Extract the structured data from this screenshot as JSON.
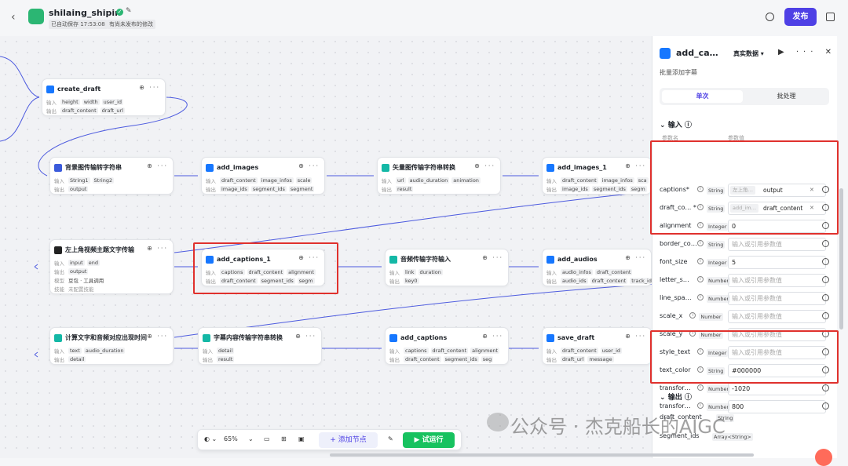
{
  "header": {
    "back": "‹",
    "title": "shilaing_shipin",
    "saved": "已自动保存 17:53:08",
    "unpublished": "有尚未发布的修改",
    "publish": "发布"
  },
  "nodes": [
    {
      "id": "create_draft",
      "title": "create_draft",
      "in_label": "输入",
      "inputs": [
        "height",
        "width",
        "user_id"
      ],
      "out_label": "输出",
      "outputs": [
        "draft_content",
        "draft_url"
      ]
    },
    {
      "id": "bg",
      "title": "背景图传输转字符串",
      "in_label": "输入",
      "inputs": [
        "String1",
        "String2"
      ],
      "out_label": "输出",
      "outputs": [
        "output"
      ]
    },
    {
      "id": "add_images",
      "title": "add_images",
      "in_label": "输入",
      "inputs": [
        "draft_content",
        "image_infos",
        "scale"
      ],
      "out_label": "输出",
      "outputs": [
        "image_ids",
        "segment_ids",
        "segment"
      ]
    },
    {
      "id": "vec",
      "title": "矢量图传输字符串转换",
      "in_label": "输入",
      "inputs": [
        "url",
        "audio_duration",
        "animation"
      ],
      "out_label": "输出",
      "outputs": [
        "result"
      ]
    },
    {
      "id": "add_images_1",
      "title": "add_images_1",
      "in_label": "输入",
      "inputs": [
        "draft_content",
        "image_infos",
        "sca"
      ],
      "out_label": "输出",
      "outputs": [
        "image_ids",
        "segment_ids",
        "segm"
      ]
    },
    {
      "id": "topleft",
      "title": "左上角视频主题文字传输",
      "in_label": "输入",
      "inputs": [
        "input",
        "end"
      ],
      "out_label": "输出",
      "outputs": [
        "output"
      ],
      "extra1_label": "模型",
      "extra1": "豆包 · 工具调用",
      "extra2_label": "技能",
      "extra2": "未配置技能"
    },
    {
      "id": "add_captions_1",
      "title": "add_captions_1",
      "in_label": "输入",
      "inputs": [
        "captions",
        "draft_content",
        "alignment"
      ],
      "out_label": "输出",
      "outputs": [
        "draft_content",
        "segment_ids",
        "segm"
      ]
    },
    {
      "id": "audio",
      "title": "音频传输字符输入",
      "in_label": "输入",
      "inputs": [
        "link",
        "duration"
      ],
      "out_label": "输出",
      "outputs": [
        "key0"
      ]
    },
    {
      "id": "add_audios",
      "title": "add_audios",
      "in_label": "输入",
      "inputs": [
        "audio_infos",
        "draft_content"
      ],
      "out_label": "输出",
      "outputs": [
        "audio_ids",
        "draft_content",
        "track_id"
      ]
    },
    {
      "id": "calc",
      "title": "计算文字和音频对应出现时间",
      "in_label": "输入",
      "inputs": [
        "text",
        "audio_duration"
      ],
      "out_label": "输出",
      "outputs": [
        "detail"
      ]
    },
    {
      "id": "captext",
      "title": "字幕内容传输字符串转换",
      "in_label": "输入",
      "inputs": [
        "detail"
      ],
      "out_label": "输出",
      "outputs": [
        "result"
      ]
    },
    {
      "id": "add_captions",
      "title": "add_captions",
      "in_label": "输入",
      "inputs": [
        "captions",
        "draft_content",
        "alignment"
      ],
      "out_label": "输出",
      "outputs": [
        "draft_content",
        "segment_ids",
        "seg"
      ]
    },
    {
      "id": "save_draft",
      "title": "save_draft",
      "in_label": "输入",
      "inputs": [
        "draft_content",
        "user_id"
      ],
      "out_label": "输出",
      "outputs": [
        "draft_url",
        "message"
      ]
    }
  ],
  "toolbar": {
    "zoom": "65%",
    "add_node": "+ 添加节点",
    "run": "▶ 试运行"
  },
  "panel": {
    "title": "add_ca…",
    "mode": "真实数据 ▾",
    "desc": "批量添加字幕",
    "tabs": [
      "单次",
      "批处理"
    ],
    "input_section": "输入",
    "col_name": "参数名",
    "col_value": "参数值",
    "params": [
      {
        "name": "captions*",
        "type": "String",
        "ref": "左上角…",
        "value": "output",
        "kind": "ref"
      },
      {
        "name": "draft_co… *",
        "type": "String",
        "ref": "add_im…",
        "value": "draft_content",
        "kind": "ref"
      },
      {
        "name": "alignment",
        "type": "Integer",
        "value": "0",
        "kind": "val"
      },
      {
        "name": "border_co…",
        "type": "String",
        "value": "输入或引用参数值",
        "kind": "ph"
      },
      {
        "name": "font_size",
        "type": "Integer",
        "value": "5",
        "kind": "val"
      },
      {
        "name": "letter_s…",
        "type": "Number",
        "value": "输入或引用参数值",
        "kind": "ph"
      },
      {
        "name": "line_spa…",
        "type": "Number",
        "value": "输入或引用参数值",
        "kind": "ph"
      },
      {
        "name": "scale_x",
        "type": "Number",
        "value": "输入或引用参数值",
        "kind": "ph"
      },
      {
        "name": "scale_y",
        "type": "Number",
        "value": "输入或引用参数值",
        "kind": "ph"
      },
      {
        "name": "style_text",
        "type": "Integer",
        "value": "输入或引用参数值",
        "kind": "ph"
      },
      {
        "name": "text_color",
        "type": "String",
        "value": "#000000",
        "kind": "val"
      },
      {
        "name": "transfor…",
        "type": "Number",
        "value": "-1020",
        "kind": "val"
      },
      {
        "name": "transfor…",
        "type": "Number",
        "value": "800",
        "kind": "val"
      }
    ],
    "output_section": "输出",
    "outputs": [
      {
        "name": "draft_content",
        "type": "String"
      },
      {
        "name": "segment_ids",
        "type": "Array<String>"
      }
    ]
  },
  "watermark": "公众号 · 杰克船长的AIGC"
}
